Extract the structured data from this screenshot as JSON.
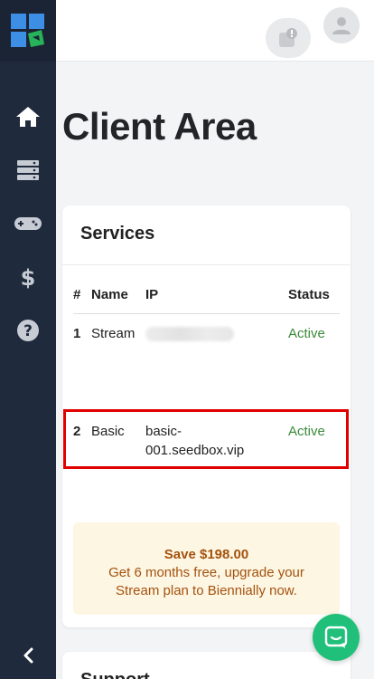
{
  "page": {
    "title": "Client Area"
  },
  "sidebar": {
    "items": [
      {
        "name": "home",
        "icon": "home-icon"
      },
      {
        "name": "servers",
        "icon": "server-icon"
      },
      {
        "name": "games",
        "icon": "gamepad-icon"
      },
      {
        "name": "billing",
        "icon": "dollar-icon"
      },
      {
        "name": "help",
        "icon": "help-icon"
      }
    ],
    "collapse_icon": "chevron-left-icon"
  },
  "services": {
    "title": "Services",
    "columns": [
      "#",
      "Name",
      "IP",
      "Status"
    ],
    "rows": [
      {
        "num": "1",
        "name": "Stream",
        "ip": "",
        "status": "Active"
      },
      {
        "num": "2",
        "name": "Basic",
        "ip_line1": "basic-",
        "ip_line2": "001.seedbox.vip",
        "status": "Active"
      }
    ]
  },
  "promo": {
    "title": "Save $198.00",
    "line1": "Get 6 months free, upgrade your",
    "line2": "Stream plan to Biennially now."
  },
  "support": {
    "title": "Support"
  },
  "colors": {
    "sidebar": "#1f2a3c",
    "active": "#3a8a3a",
    "promo_bg": "#fdf6e3",
    "promo_text": "#a4520e",
    "chat": "#20c07a",
    "highlight": "#e00000"
  }
}
